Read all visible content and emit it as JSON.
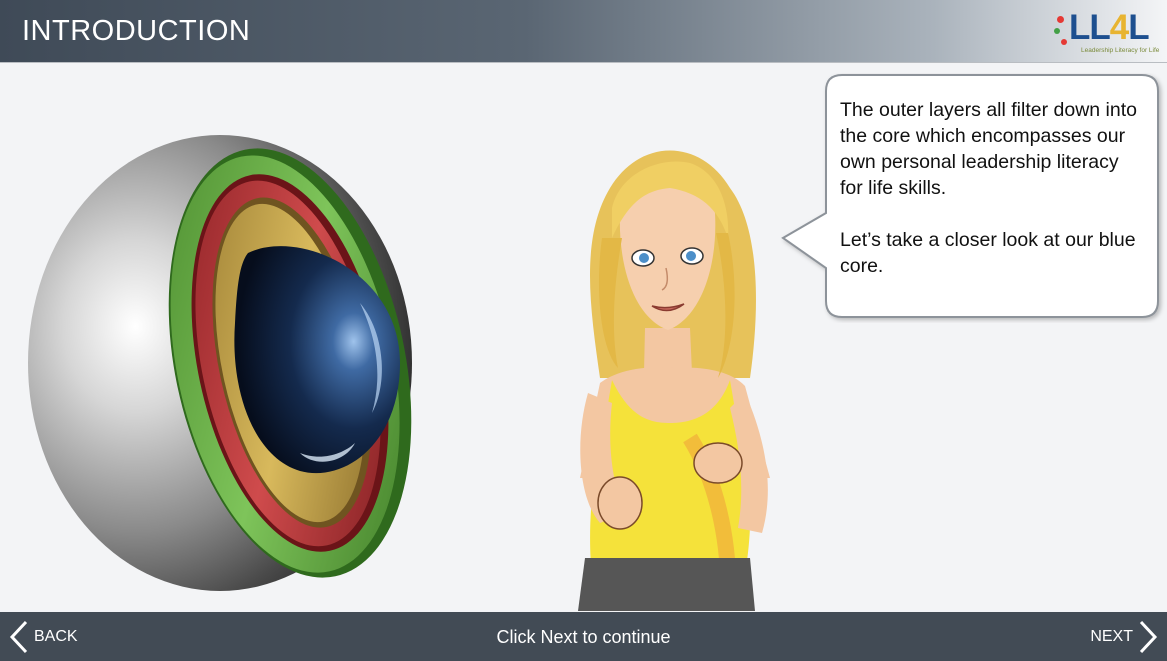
{
  "header": {
    "title": "INTRODUCTION",
    "logo_text": "LL4L",
    "logo_tagline": "Leadership Literacy for Life"
  },
  "speech_bubble": {
    "paragraph1": "The outer layers all filter down into the core which encompasses our own personal leadership literacy for life skills.",
    "paragraph2": "Let’s take a closer look at our blue core."
  },
  "footer": {
    "back_label": "BACK",
    "next_label": "NEXT",
    "instruction": "Click Next to continue"
  },
  "colors": {
    "header_dark": "#3f4a57",
    "footer_bg": "#424b55",
    "layer_green": "#5aa33b",
    "layer_red": "#b7383a",
    "layer_gold": "#c9a84a",
    "core_blue": "#1d3a66",
    "shirt_yellow": "#f5e23a"
  },
  "icons": {
    "back": "chevron-left-icon",
    "next": "chevron-right-icon"
  }
}
